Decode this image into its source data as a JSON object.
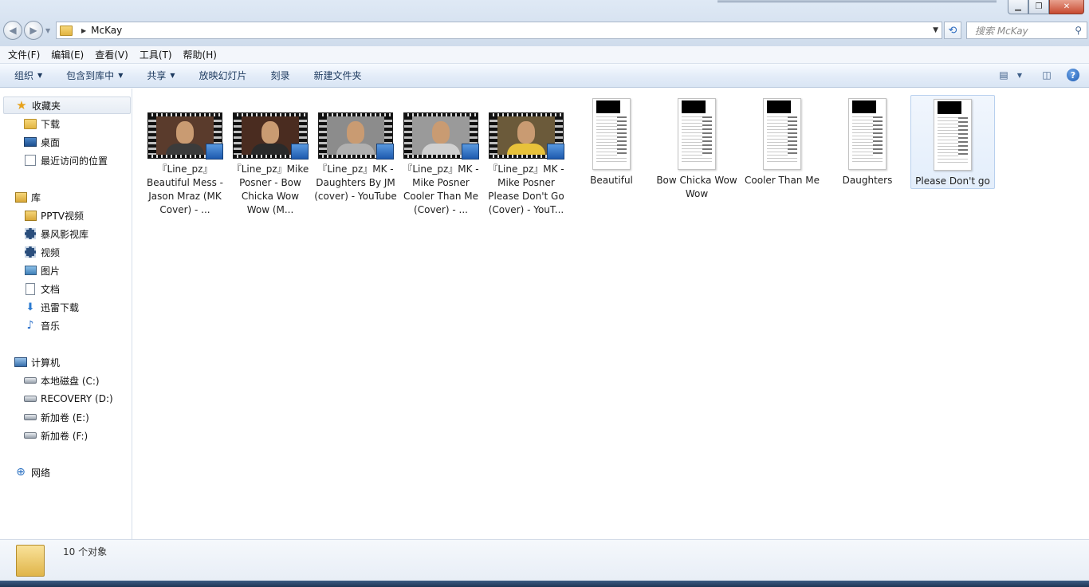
{
  "address": {
    "breadcrumb": "McKay"
  },
  "search": {
    "placeholder": "搜索 McKay"
  },
  "menu": [
    "文件(F)",
    "编辑(E)",
    "查看(V)",
    "工具(T)",
    "帮助(H)"
  ],
  "commands": {
    "organize": "组织",
    "include_library": "包含到库中",
    "share": "共享",
    "slideshow": "放映幻灯片",
    "burn": "刻录",
    "new_folder": "新建文件夹"
  },
  "nav": {
    "favorites": {
      "label": "收藏夹",
      "items": [
        "下载",
        "桌面",
        "最近访问的位置"
      ]
    },
    "libraries": {
      "label": "库",
      "items": [
        "PPTV视频",
        "暴风影视库",
        "视频",
        "图片",
        "文档",
        "迅雷下载",
        "音乐"
      ]
    },
    "computer": {
      "label": "计算机",
      "items": [
        "本地磁盘 (C:)",
        "RECOVERY (D:)",
        "新加卷 (E:)",
        "新加卷 (F:)"
      ]
    },
    "network": {
      "label": "网络"
    }
  },
  "files": [
    {
      "label": "『Line_pz』Beautiful Mess - Jason Mraz (MK Cover) - ...",
      "kind": "video",
      "tint": "#5a3b2c",
      "shirt": "#3b3b3b"
    },
    {
      "label": "『Line_pz』Mike Posner - Bow Chicka Wow Wow (M...",
      "kind": "video",
      "tint": "#4a2c20",
      "shirt": "#2a2a2a"
    },
    {
      "label": "『Line_pz』MK - Daughters By JM (cover) - YouTube",
      "kind": "video",
      "tint": "#8c8c8c",
      "shirt": "#b0b0b0"
    },
    {
      "label": "『Line_pz』MK - Mike Posner Cooler Than Me (Cover) - ...",
      "kind": "video",
      "tint": "#9a9a9a",
      "shirt": "#d0d0d0"
    },
    {
      "label": "『Line_pz』MK - Mike Posner Please Don't Go (Cover) - YouT...",
      "kind": "video",
      "tint": "#6b5a3a",
      "shirt": "#e8c23a"
    },
    {
      "label": "Beautiful",
      "kind": "doc"
    },
    {
      "label": "Bow Chicka Wow Wow",
      "kind": "doc"
    },
    {
      "label": "Cooler Than Me",
      "kind": "doc"
    },
    {
      "label": "Daughters",
      "kind": "doc"
    },
    {
      "label": "Please Don't go",
      "kind": "doc",
      "selected": true
    }
  ],
  "status": {
    "count": "10 个对象"
  }
}
